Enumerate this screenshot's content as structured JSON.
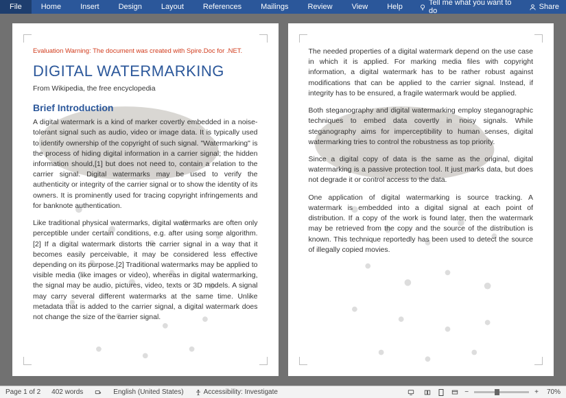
{
  "ribbon": {
    "tabs": [
      "File",
      "Home",
      "Insert",
      "Design",
      "Layout",
      "References",
      "Mailings",
      "Review",
      "View",
      "Help"
    ],
    "tell": "Tell me what you want to do",
    "share": "Share"
  },
  "doc": {
    "warning": "Evaluation Warning: The document was created with Spire.Doc for .NET.",
    "title": "DIGITAL WATERMARKING",
    "subtitle": "From Wikipedia, the free encyclopedia",
    "heading1": "Brief Introduction",
    "p1": "A digital watermark is a kind of marker covertly embedded in a noise-tolerant signal such as audio, video or image data. It is typically used to identify ownership of the copyright of such signal. \"Watermarking\" is the process of hiding digital information in a carrier signal; the hidden information should,[1] but does not need to, contain a relation to the carrier signal. Digital watermarks may be used to verify the authenticity or integrity of the carrier signal or to show the identity of its owners. It is prominently used for tracing copyright infringements and for banknote authentication.",
    "p2": "Like traditional physical watermarks, digital watermarks are often only perceptible under certain conditions, e.g. after using some algorithm.[2] If a digital watermark distorts the carrier signal in a way that it becomes easily perceivable, it may be considered less effective depending on its purpose.[2] Traditional watermarks may be applied to visible media (like images or video), whereas in digital watermarking, the signal may be audio, pictures, video, texts or 3D models. A signal may carry several different watermarks at the same time. Unlike metadata that is added to the carrier signal, a digital watermark does not change the size of the carrier signal.",
    "p3": "The needed properties of a digital watermark depend on the use case in which it is applied. For marking media files with copyright information, a digital watermark has to be rather robust against modifications that can be applied to the carrier signal. Instead, if integrity has to be ensured, a fragile watermark would be applied.",
    "p4": "Both steganography and digital watermarking employ steganographic techniques to embed data covertly in noisy signals. While steganography aims for imperceptibility to human senses, digital watermarking tries to control the robustness as top priority.",
    "p5": "Since a digital copy of data is the same as the original, digital watermarking is a passive protection tool. It just marks data, but does not degrade it or control access to the data.",
    "p6": "One application of digital watermarking is source tracking. A watermark is embedded into a digital signal at each point of distribution. If a copy of the work is found later, then the watermark may be retrieved from the copy and the source of the distribution is known. This technique reportedly has been used to detect the source of illegally copied movies."
  },
  "status": {
    "page": "Page 1 of 2",
    "words": "402 words",
    "lang": "English (United States)",
    "access": "Accessibility: Investigate",
    "zoom": "70%"
  }
}
